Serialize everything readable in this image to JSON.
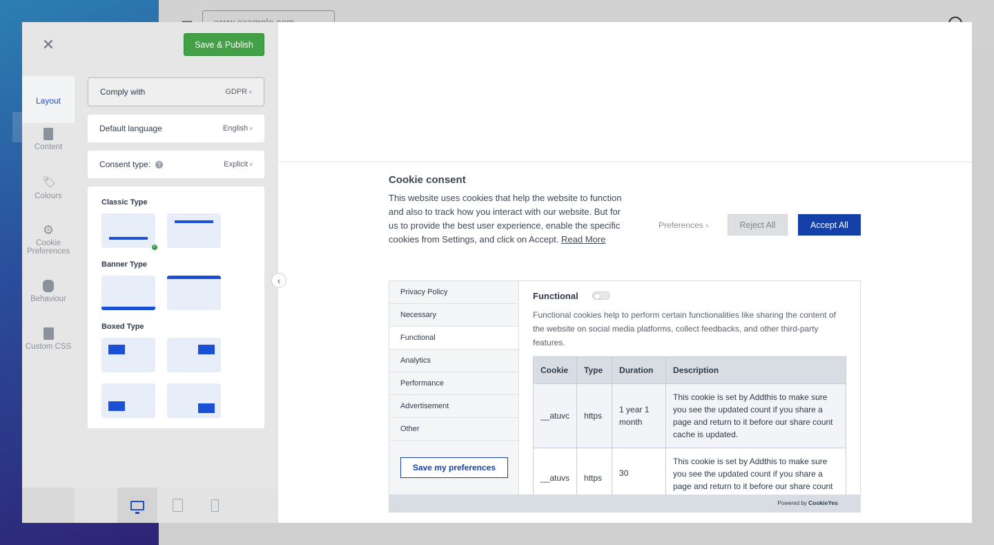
{
  "background": {
    "url_text": "www.example.com"
  },
  "editor": {
    "save_publish": "Save & Publish",
    "rail": [
      {
        "label": "Layout",
        "icon": "layout-grid-icon"
      },
      {
        "label": "Content",
        "icon": "document-icon"
      },
      {
        "label": "Colours",
        "icon": "tag-icon"
      },
      {
        "label": "Cookie Preferences",
        "icon": "gear-icon"
      },
      {
        "label": "Behaviour",
        "icon": "toggle-icon"
      },
      {
        "label": "Custom CSS",
        "icon": "css-file-icon"
      }
    ],
    "comply": {
      "label": "Comply with",
      "value": "GDPR"
    },
    "language": {
      "label": "Default language",
      "value": "English"
    },
    "consent": {
      "label": "Consent type:",
      "value": "Explicit"
    },
    "layout_types": {
      "classic": "Classic Type",
      "banner": "Banner Type",
      "boxed": "Boxed Type"
    }
  },
  "banner": {
    "title": "Cookie consent",
    "description": "This website uses cookies that help the website to function and also to track how you interact with our website. But for us to provide the best user experience, enable the specific cookies from Settings, and click on Accept.",
    "read_more": "Read More",
    "preferences": "Preferences",
    "reject_all": "Reject All",
    "accept_all": "Accept All"
  },
  "preference_center": {
    "tabs": [
      "Privacy Policy",
      "Necessary",
      "Functional",
      "Analytics",
      "Performance",
      "Advertisement",
      "Other"
    ],
    "active_tab": "Functional",
    "save_preferences": "Save my preferences",
    "section_title": "Functional",
    "section_description": "Functional cookies help to perform certain functionalities like sharing the content of the website on social media platforms, collect feedbacks, and other third-party features.",
    "table": {
      "headers": [
        "Cookie",
        "Type",
        "Duration",
        "Description"
      ],
      "rows": [
        [
          "__atuvc",
          "https",
          "1 year 1 month",
          "This cookie is set by Addthis to make sure you see the updated count if you share a page and return to it before our share count cache is updated."
        ],
        [
          "__atuvs",
          "https",
          "30",
          "This cookie is set by Addthis to make sure you see the updated count if you share a page and return to it before our share count cache is updated."
        ]
      ]
    },
    "powered_by_prefix": "Powered by",
    "powered_by_brand": "CookieYes"
  }
}
